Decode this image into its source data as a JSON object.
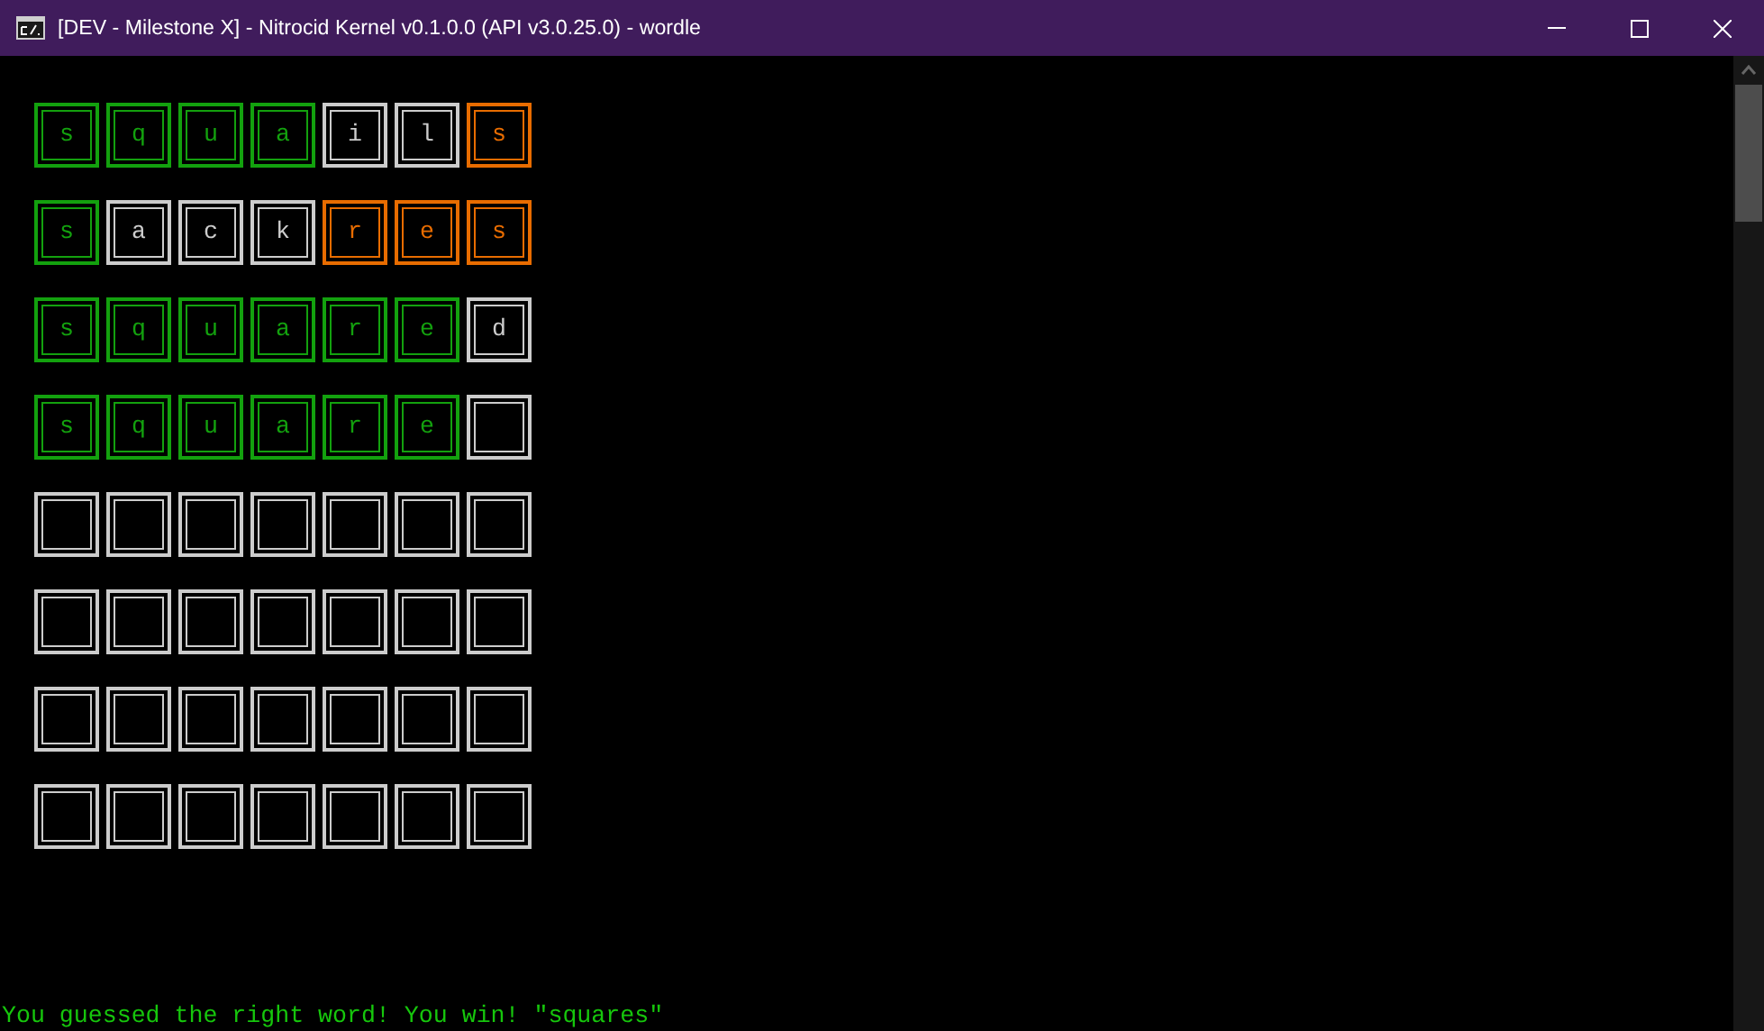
{
  "window": {
    "title": "[DEV - Milestone X] - Nitrocid Kernel v0.1.0.0 (API v3.0.25.0) - wordle"
  },
  "board": [
    [
      {
        "letter": "s",
        "color": "#13a10e"
      },
      {
        "letter": "q",
        "color": "#13a10e"
      },
      {
        "letter": "u",
        "color": "#13a10e"
      },
      {
        "letter": "a",
        "color": "#13a10e"
      },
      {
        "letter": "i",
        "color": "#cccccc"
      },
      {
        "letter": "l",
        "color": "#cccccc"
      },
      {
        "letter": "s",
        "color": "#e86c00"
      }
    ],
    [
      {
        "letter": "s",
        "color": "#13a10e"
      },
      {
        "letter": "a",
        "color": "#cccccc"
      },
      {
        "letter": "c",
        "color": "#cccccc"
      },
      {
        "letter": "k",
        "color": "#cccccc"
      },
      {
        "letter": "r",
        "color": "#e86c00"
      },
      {
        "letter": "e",
        "color": "#e86c00"
      },
      {
        "letter": "s",
        "color": "#e86c00"
      }
    ],
    [
      {
        "letter": "s",
        "color": "#13a10e"
      },
      {
        "letter": "q",
        "color": "#13a10e"
      },
      {
        "letter": "u",
        "color": "#13a10e"
      },
      {
        "letter": "a",
        "color": "#13a10e"
      },
      {
        "letter": "r",
        "color": "#13a10e"
      },
      {
        "letter": "e",
        "color": "#13a10e"
      },
      {
        "letter": "d",
        "color": "#cccccc"
      }
    ],
    [
      {
        "letter": "s",
        "color": "#13a10e"
      },
      {
        "letter": "q",
        "color": "#13a10e"
      },
      {
        "letter": "u",
        "color": "#13a10e"
      },
      {
        "letter": "a",
        "color": "#13a10e"
      },
      {
        "letter": "r",
        "color": "#13a10e"
      },
      {
        "letter": "e",
        "color": "#13a10e"
      },
      {
        "color": "#cccccc"
      }
    ],
    [
      {
        "color": "#cccccc"
      },
      {
        "color": "#cccccc"
      },
      {
        "color": "#cccccc"
      },
      {
        "color": "#cccccc"
      },
      {
        "color": "#cccccc"
      },
      {
        "color": "#cccccc"
      },
      {
        "color": "#cccccc"
      }
    ],
    [
      {
        "color": "#cccccc"
      },
      {
        "color": "#cccccc"
      },
      {
        "color": "#cccccc"
      },
      {
        "color": "#cccccc"
      },
      {
        "color": "#cccccc"
      },
      {
        "color": "#cccccc"
      },
      {
        "color": "#cccccc"
      }
    ],
    [
      {
        "color": "#cccccc"
      },
      {
        "color": "#cccccc"
      },
      {
        "color": "#cccccc"
      },
      {
        "color": "#cccccc"
      },
      {
        "color": "#cccccc"
      },
      {
        "color": "#cccccc"
      },
      {
        "color": "#cccccc"
      }
    ],
    [
      {
        "color": "#cccccc"
      },
      {
        "color": "#cccccc"
      },
      {
        "color": "#cccccc"
      },
      {
        "color": "#cccccc"
      },
      {
        "color": "#cccccc"
      },
      {
        "color": "#cccccc"
      },
      {
        "color": "#cccccc"
      }
    ]
  ],
  "message": "You guessed the right word! You win! \"squares\""
}
